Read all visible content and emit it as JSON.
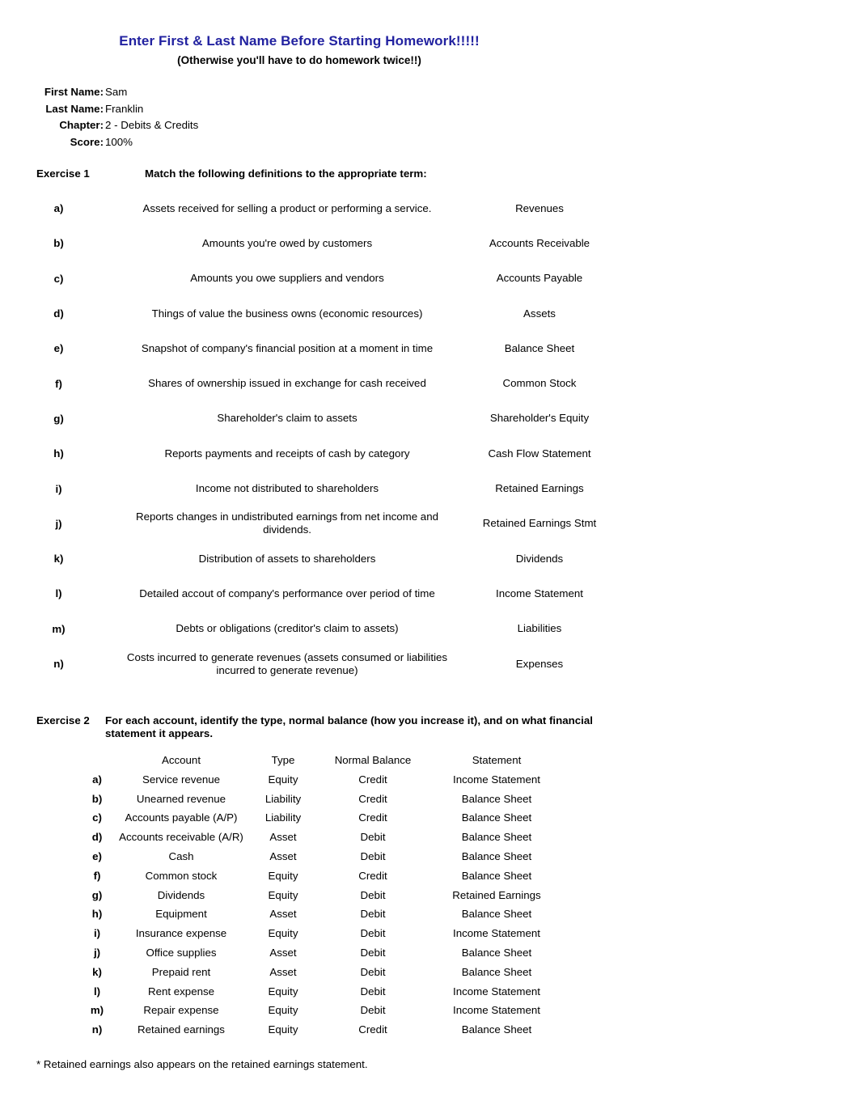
{
  "document": {
    "title_main": "Enter First & Last Name Before Starting Homework!!!!!",
    "title_sub": "(Otherwise you'll have to do homework twice!!)",
    "title_color": "#2222A0"
  },
  "header_fields": {
    "first_name_label": "First Name:",
    "first_name_value": "Sam",
    "last_name_label": "Last Name:",
    "last_name_value": "Franklin",
    "chapter_label": "Chapter:",
    "chapter_value": "2 - Debits & Credits",
    "score_label": "Score:",
    "score_value": "100%"
  },
  "exercise1": {
    "label": "Exercise 1",
    "instruction": "Match the following definitions to the appropriate term:",
    "rows": [
      {
        "letter": "a)",
        "definition": "Assets received for selling a product or performing a service.",
        "term": "Revenues"
      },
      {
        "letter": "b)",
        "definition": "Amounts you're owed by customers",
        "term": "Accounts Receivable"
      },
      {
        "letter": "c)",
        "definition": "Amounts you owe suppliers and vendors",
        "term": "Accounts Payable"
      },
      {
        "letter": "d)",
        "definition": "Things of value the business owns (economic resources)",
        "term": "Assets"
      },
      {
        "letter": "e)",
        "definition": "Snapshot of company's financial position at a moment in time",
        "term": "Balance Sheet"
      },
      {
        "letter": "f)",
        "definition": "Shares of ownership issued in exchange for cash received",
        "term": "Common Stock"
      },
      {
        "letter": "g)",
        "definition": "Shareholder's claim to assets",
        "term": "Shareholder's Equity"
      },
      {
        "letter": "h)",
        "definition": "Reports payments and receipts of cash by category",
        "term": "Cash Flow Statement"
      },
      {
        "letter": "i)",
        "definition": "Income not distributed to shareholders",
        "term": "Retained Earnings"
      },
      {
        "letter": "j)",
        "definition": "Reports changes in undistributed earnings from net income and dividends.",
        "term": "Retained Earnings Stmt"
      },
      {
        "letter": "k)",
        "definition": "Distribution of assets to shareholders",
        "term": "Dividends"
      },
      {
        "letter": "l)",
        "definition": "Detailed accout of company's performance over period of time",
        "term": "Income Statement"
      },
      {
        "letter": "m)",
        "definition": "Debts or obligations (creditor's claim to assets)",
        "term": "Liabilities"
      },
      {
        "letter": "n)",
        "definition": "Costs incurred to generate revenues (assets consumed or liabilities incurred to generate revenue)",
        "term": "Expenses"
      }
    ]
  },
  "exercise2": {
    "label": "Exercise 2",
    "instruction": "For each account, identify the type, normal balance (how you increase it), and on what financial statement it appears.",
    "columns": {
      "account": "Account",
      "type": "Type",
      "normal_balance": "Normal Balance",
      "statement": "Statement"
    },
    "rows": [
      {
        "letter": "a)",
        "account": "Service revenue",
        "type": "Equity",
        "normal_balance": "Credit",
        "statement": "Income Statement"
      },
      {
        "letter": "b)",
        "account": "Unearned revenue",
        "type": "Liability",
        "normal_balance": "Credit",
        "statement": "Balance Sheet"
      },
      {
        "letter": "c)",
        "account": "Accounts payable (A/P)",
        "type": "Liability",
        "normal_balance": "Credit",
        "statement": "Balance Sheet"
      },
      {
        "letter": "d)",
        "account": "Accounts receivable (A/R)",
        "type": "Asset",
        "normal_balance": "Debit",
        "statement": "Balance Sheet"
      },
      {
        "letter": "e)",
        "account": "Cash",
        "type": "Asset",
        "normal_balance": "Debit",
        "statement": "Balance Sheet"
      },
      {
        "letter": "f)",
        "account": "Common stock",
        "type": "Equity",
        "normal_balance": "Credit",
        "statement": "Balance Sheet"
      },
      {
        "letter": "g)",
        "account": "Dividends",
        "type": "Equity",
        "normal_balance": "Debit",
        "statement": "Retained Earnings"
      },
      {
        "letter": "h)",
        "account": "Equipment",
        "type": "Asset",
        "normal_balance": "Debit",
        "statement": "Balance Sheet"
      },
      {
        "letter": "i)",
        "account": "Insurance expense",
        "type": "Equity",
        "normal_balance": "Debit",
        "statement": "Income Statement"
      },
      {
        "letter": "j)",
        "account": "Office supplies",
        "type": "Asset",
        "normal_balance": "Debit",
        "statement": "Balance Sheet"
      },
      {
        "letter": "k)",
        "account": "Prepaid rent",
        "type": "Asset",
        "normal_balance": "Debit",
        "statement": "Balance Sheet"
      },
      {
        "letter": "l)",
        "account": "Rent expense",
        "type": "Equity",
        "normal_balance": "Debit",
        "statement": "Income Statement"
      },
      {
        "letter": "m)",
        "account": "Repair expense",
        "type": "Equity",
        "normal_balance": "Debit",
        "statement": "Income Statement"
      },
      {
        "letter": "n)",
        "account": "Retained earnings",
        "type": "Equity",
        "normal_balance": "Credit",
        "statement": "Balance Sheet"
      }
    ]
  },
  "footnote": "* Retained earnings also appears on the retained earnings statement."
}
